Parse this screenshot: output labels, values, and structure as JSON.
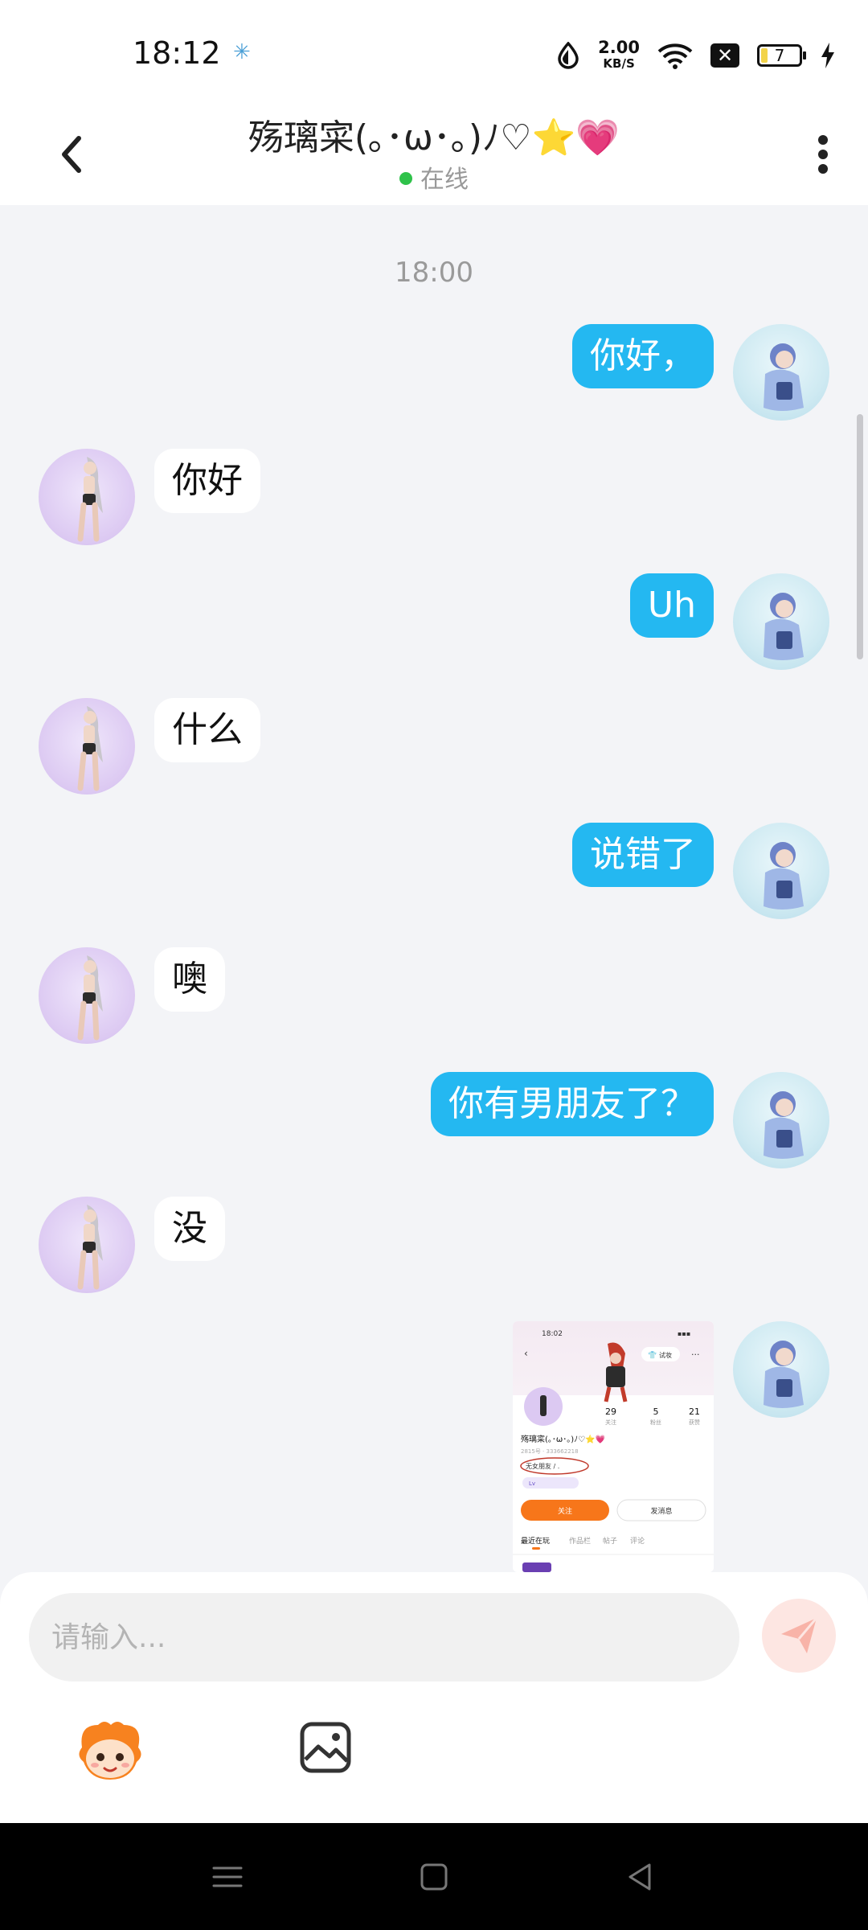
{
  "status": {
    "time": "18:12",
    "net_speed_value": "2.00",
    "net_speed_unit": "KB/S",
    "battery": "7"
  },
  "header": {
    "title": "殇璃寀(｡･ω･｡)ﾉ♡⭐💗",
    "status": "在线"
  },
  "chat": {
    "timestamp": "18:00",
    "messages": [
      {
        "sender": "me",
        "text": "你好，"
      },
      {
        "sender": "other",
        "text": "你好"
      },
      {
        "sender": "me",
        "text": "Uh"
      },
      {
        "sender": "other",
        "text": "什么"
      },
      {
        "sender": "me",
        "text": "说错了"
      },
      {
        "sender": "other",
        "text": "噢"
      },
      {
        "sender": "me",
        "text": "你有男朋友了？"
      },
      {
        "sender": "other",
        "text": "没"
      }
    ],
    "image_message": {
      "time": "18:02",
      "follow_button": "试妆",
      "stats": [
        {
          "value": "29",
          "label": "关注"
        },
        {
          "value": "5",
          "label": "粉丝"
        },
        {
          "value": "21",
          "label": "获赞"
        }
      ],
      "name": "殇璃寀(｡･ω･｡)ﾉ♡⭐💗",
      "id_line": "2815号 · 333662218",
      "bio": "无女朋友 / .",
      "tag": "Lv",
      "follow": "关注",
      "message": "发消息",
      "tabs": [
        "最近在玩",
        "作品栏",
        "帖子",
        "评论"
      ]
    }
  },
  "input": {
    "placeholder": "请输入..."
  },
  "colors": {
    "bubble_me": "#24b8f1",
    "bubble_other": "#ffffff",
    "accent_orange": "#f7761a",
    "online": "#2fc24a"
  }
}
